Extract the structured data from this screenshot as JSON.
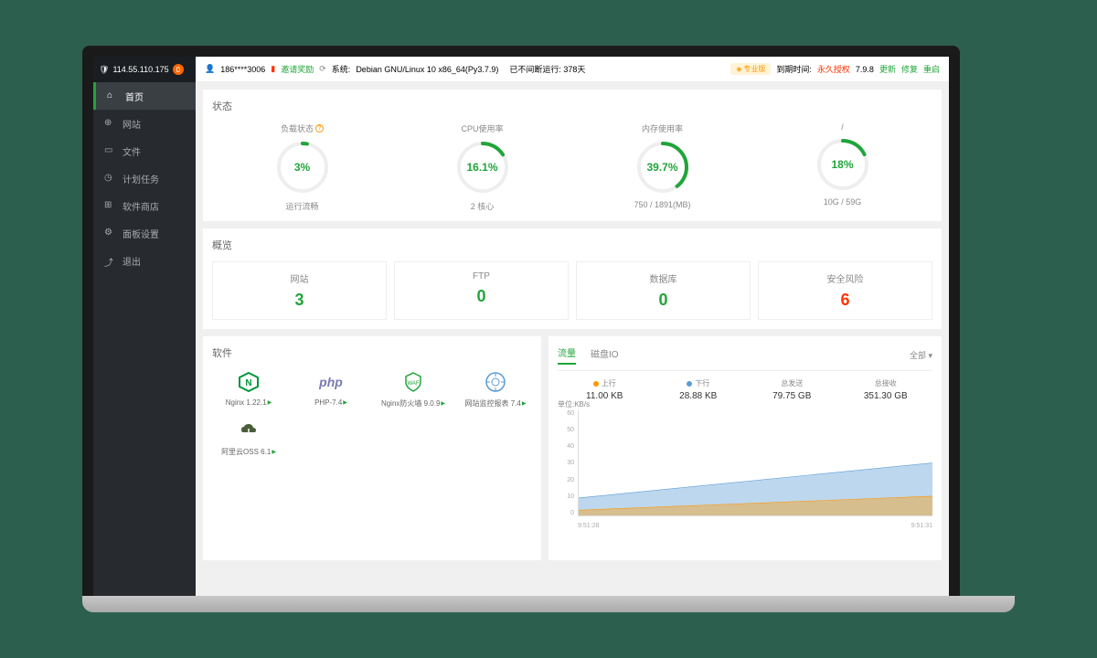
{
  "sidebar": {
    "ip": "114.55.110.175",
    "badge": "0",
    "items": [
      {
        "label": "首页",
        "icon": "home",
        "active": true
      },
      {
        "label": "网站",
        "icon": "globe"
      },
      {
        "label": "文件",
        "icon": "folder"
      },
      {
        "label": "计划任务",
        "icon": "clock"
      },
      {
        "label": "软件商店",
        "icon": "grid"
      },
      {
        "label": "面板设置",
        "icon": "gear"
      },
      {
        "label": "退出",
        "icon": "exit"
      }
    ]
  },
  "topbar": {
    "user_icon": "user",
    "user": "186****3006",
    "invite": "邀请奖励",
    "system_label": "系统:",
    "system": "Debian GNU/Linux 10 x86_64(Py3.7.9)",
    "uptime": "已不间断运行: 378天",
    "pro_badge": "专业版",
    "expire_label": "到期时间:",
    "expire": "永久授权",
    "version": "7.9.8",
    "links": [
      "更新",
      "修复",
      "重启"
    ]
  },
  "status": {
    "title": "状态",
    "items": [
      {
        "label": "负载状态",
        "value": "3%",
        "pct": 3,
        "sub": "运行流畅",
        "info": true
      },
      {
        "label": "CPU使用率",
        "value": "16.1%",
        "pct": 16.1,
        "sub": "2 核心"
      },
      {
        "label": "内存使用率",
        "value": "39.7%",
        "pct": 39.7,
        "sub": "750 / 1891(MB)"
      },
      {
        "label": "/",
        "value": "18%",
        "pct": 18,
        "sub": "10G / 59G"
      }
    ]
  },
  "overview": {
    "title": "概览",
    "items": [
      {
        "label": "网站",
        "value": "3",
        "color": "#20a53a"
      },
      {
        "label": "FTP",
        "value": "0",
        "color": "#20a53a"
      },
      {
        "label": "数据库",
        "value": "0",
        "color": "#20a53a"
      },
      {
        "label": "安全风险",
        "value": "6",
        "color": "#ff3300"
      }
    ]
  },
  "software": {
    "title": "软件",
    "items": [
      {
        "name": "Nginx 1.22.1",
        "icon": "nginx"
      },
      {
        "name": "PHP-7.4",
        "icon": "php"
      },
      {
        "name": "Nginx防火墙 9.0.9",
        "icon": "waf"
      },
      {
        "name": "网站监控报表 7.4",
        "icon": "monitor"
      },
      {
        "name": "阿里云OSS 6.1",
        "icon": "oss"
      }
    ]
  },
  "traffic": {
    "tabs": [
      "流量",
      "磁盘IO"
    ],
    "active_tab": 0,
    "all": "全部",
    "stats": [
      {
        "label": "上行",
        "value": "11.00 KB",
        "dot": "orange"
      },
      {
        "label": "下行",
        "value": "28.88 KB",
        "dot": "blue"
      },
      {
        "label": "总发送",
        "value": "79.75 GB"
      },
      {
        "label": "总接收",
        "value": "351.30 GB"
      }
    ],
    "unit": "单位:KB/s"
  },
  "chart_data": {
    "type": "area",
    "ylabel": "KB/s",
    "ylim": [
      0,
      60
    ],
    "yticks": [
      0,
      10,
      20,
      30,
      40,
      50,
      60
    ],
    "x": [
      "9:51:28",
      "9:51:31"
    ],
    "series": [
      {
        "name": "下行",
        "values": [
          10,
          30
        ],
        "color": "#5b9bd5"
      },
      {
        "name": "上行",
        "values": [
          3,
          11
        ],
        "color": "#ff9900"
      }
    ]
  }
}
